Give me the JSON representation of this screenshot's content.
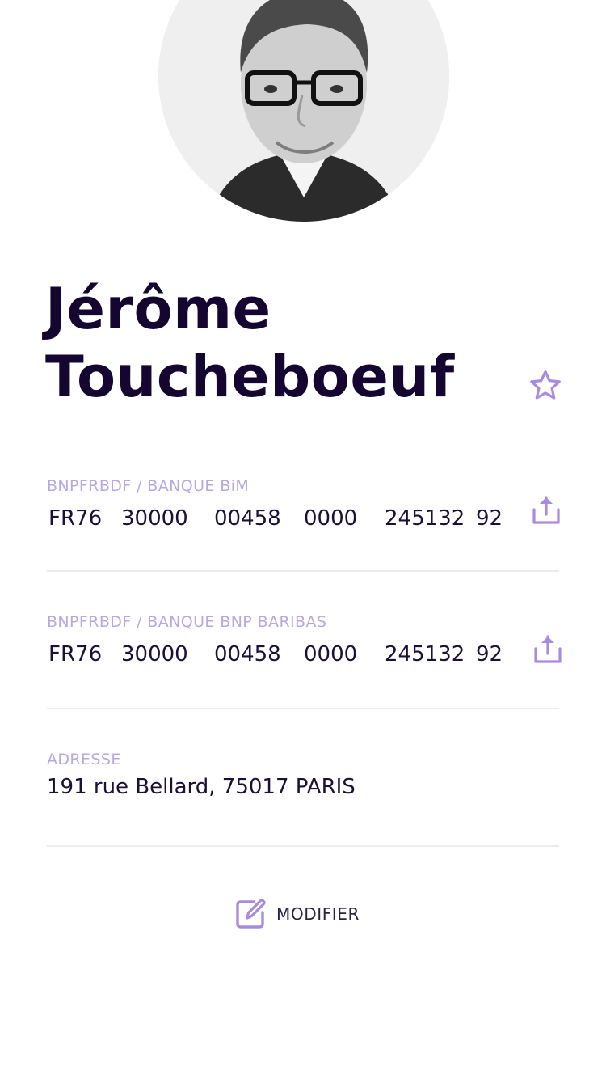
{
  "contact": {
    "first_name": "Jérôme",
    "last_name": "Toucheboeuf",
    "favorite_icon": "star-outline-icon"
  },
  "accounts": [
    {
      "label": "BNPFRBDF / BANQUE BiM",
      "iban_groups": [
        "FR76",
        "30000",
        "00458",
        "0000",
        "245132",
        "92"
      ],
      "share_icon": "share-icon"
    },
    {
      "label": "BNPFRBDF / BANQUE BNP BARIBAS",
      "iban_groups": [
        "FR76",
        "30000",
        "00458",
        "0000",
        "245132",
        "92"
      ],
      "share_icon": "share-icon"
    }
  ],
  "address": {
    "label": "ADRESSE",
    "value": "191 rue Bellard, 75017 PARIS"
  },
  "actions": {
    "modify_label": "MODIFIER",
    "modify_icon": "edit-icon"
  },
  "colors": {
    "accent": "#a78be0",
    "label": "#b7a9df",
    "heading": "#150631",
    "text": "#1b1036",
    "divider": "#ececee"
  }
}
